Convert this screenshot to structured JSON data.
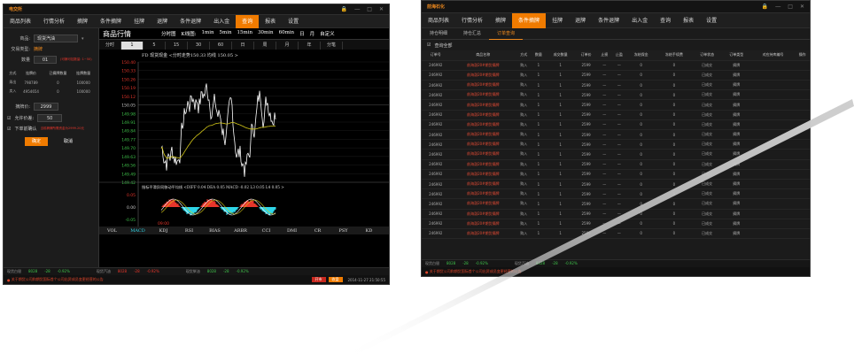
{
  "left": {
    "logo": "电交所",
    "menu": [
      "商品列表",
      "行情分析",
      "摘牌",
      "条件摘牌",
      "挂牌",
      "退牌",
      "条件退牌",
      "出入金",
      "查询",
      "报表",
      "设置"
    ],
    "active_menu": "查询",
    "form": {
      "product_label": "商品:",
      "product_value": "现货汽油",
      "trade_type_label": "交易类型:",
      "trade_type_value": "摘牌",
      "qty_label": "数量",
      "qty_value": "01",
      "qty_hint": "(可摘可挂数量: 1~50)",
      "book_headers": [
        "方式",
        "挂牌价",
        "已摘牌数量",
        "挂牌数量"
      ],
      "book_rows": [
        {
          "side": "乘出",
          "price": "798789",
          "filled": "0",
          "total": "100000"
        },
        {
          "side": "卖入",
          "price": "4954654",
          "filled": "0",
          "total": "100000"
        }
      ],
      "price_label": "摘牌价:",
      "price_value": "2999",
      "deviation_label": "允许价差:",
      "deviation_value": "50",
      "confirm_label": "下单前确认",
      "confirm_hint": "当前摘牌所需资金为2999.20元",
      "ok_label": "确定",
      "cancel_label": "取消"
    },
    "chart_header": {
      "title": "商品行情",
      "tabs": [
        "分时图",
        "K线图:",
        "1min",
        "5min",
        "15min",
        "30min",
        "60min",
        "日",
        "月",
        "自定义"
      ]
    },
    "period_tabs": [
      "分时",
      "1",
      "5",
      "15",
      "30",
      "60",
      "日",
      "周",
      "月",
      "年",
      "分笔"
    ],
    "active_period": "1",
    "chart_legend": "FD 现货现金 <分时走势150.33 均线 150.05 >",
    "price_ticks": [
      "150.40",
      "150.33",
      "150.26",
      "150.19",
      "150.12",
      "150.05",
      "149.98",
      "149.91",
      "149.84",
      "149.77",
      "149.70",
      "149.63",
      "149.56",
      "149.49",
      "149.42"
    ],
    "indicator_legend": "指标平滑异同移动平均线 <DIFF 0.04  DEA 0.05  MACD -0.02  L3 0.05  L4 0.05 >",
    "indicator_ticks": [
      "0.05",
      "0.00",
      "-0.05"
    ],
    "time_label": "09:00",
    "indicators": [
      "VOL",
      "MACD",
      "KDJ",
      "RSI",
      "BIAS",
      "ARBR",
      "CCI",
      "DMI",
      "CR",
      "PSY",
      "KD"
    ],
    "active_indicator": "MACD",
    "status": [
      {
        "name": "现货白银",
        "price": "8028",
        "change": "-28",
        "pct": "-0.92%"
      },
      {
        "name": "现货汽油",
        "price": "8028",
        "change": "-28",
        "pct": "-0.92%"
      },
      {
        "name": "现货柴油",
        "price": "8028",
        "change": "-28",
        "pct": "-0.92%"
      }
    ],
    "notice": "关于期货公司和期货国际首个公司出资成员变更经营的公告",
    "btn_open": "开市",
    "btn_state": "收盘",
    "datetime": "2014-11-27 21:50:55"
  },
  "right": {
    "logo": "前海石化",
    "menu": [
      "商品列表",
      "行情分析",
      "摘牌",
      "条件摘牌",
      "挂牌",
      "退牌",
      "条件退牌",
      "出入金",
      "查询",
      "报表",
      "设置"
    ],
    "active_menu": "条件摘牌",
    "subtabs": [
      "持仓明细",
      "持仓汇总",
      "订单查询"
    ],
    "active_subtab": "订单查询",
    "query_all": "查询全部",
    "headers": [
      "订单号",
      "商品名称",
      "方式",
      "数量",
      "成交数量",
      "订单价",
      "止损",
      "止盈",
      "冻结保金",
      "冻结手续费",
      "订单状态",
      "订单类型",
      "对应持库编号",
      "操作"
    ],
    "rows": [
      {
        "id": "246992",
        "name": "前海渤20#期货摘牌",
        "side": "购入",
        "qty": "1",
        "filled": "1",
        "price": "2599",
        "sl": "—",
        "tp": "—",
        "fm": "0",
        "ff": "0",
        "status": "已成交",
        "type": "摘牌"
      },
      {
        "id": "246992",
        "name": "前海渤20#期货摘牌",
        "side": "购入",
        "qty": "1",
        "filled": "1",
        "price": "2599",
        "sl": "—",
        "tp": "—",
        "fm": "0",
        "ff": "0",
        "status": "已成交",
        "type": "摘牌"
      },
      {
        "id": "246992",
        "name": "前海渤20#期货摘牌",
        "side": "购入",
        "qty": "1",
        "filled": "1",
        "price": "2599",
        "sl": "—",
        "tp": "—",
        "fm": "0",
        "ff": "0",
        "status": "已成交",
        "type": "摘牌"
      },
      {
        "id": "246992",
        "name": "前海渤20#期货摘牌",
        "side": "购入",
        "qty": "1",
        "filled": "1",
        "price": "2599",
        "sl": "—",
        "tp": "—",
        "fm": "0",
        "ff": "0",
        "status": "已成交",
        "type": "摘牌"
      },
      {
        "id": "246992",
        "name": "前海渤20#期货摘牌",
        "side": "购入",
        "qty": "1",
        "filled": "1",
        "price": "2599",
        "sl": "—",
        "tp": "—",
        "fm": "0",
        "ff": "0",
        "status": "已成交",
        "type": "摘牌"
      },
      {
        "id": "246992",
        "name": "前海渤20#期货摘牌",
        "side": "购入",
        "qty": "1",
        "filled": "1",
        "price": "2599",
        "sl": "—",
        "tp": "—",
        "fm": "0",
        "ff": "0",
        "status": "已成交",
        "type": "摘牌"
      },
      {
        "id": "246992",
        "name": "前海渤20#期货摘牌",
        "side": "购入",
        "qty": "1",
        "filled": "1",
        "price": "2599",
        "sl": "—",
        "tp": "—",
        "fm": "0",
        "ff": "0",
        "status": "已成交",
        "type": "摘牌"
      },
      {
        "id": "246992",
        "name": "前海渤20#期货摘牌",
        "side": "购入",
        "qty": "1",
        "filled": "1",
        "price": "2599",
        "sl": "—",
        "tp": "—",
        "fm": "0",
        "ff": "0",
        "status": "已成交",
        "type": "摘牌"
      },
      {
        "id": "246992",
        "name": "前海渤20#期货摘牌",
        "side": "购入",
        "qty": "1",
        "filled": "1",
        "price": "2599",
        "sl": "—",
        "tp": "—",
        "fm": "0",
        "ff": "0",
        "status": "已成交",
        "type": "摘牌"
      },
      {
        "id": "246992",
        "name": "前海渤20#期货摘牌",
        "side": "购入",
        "qty": "1",
        "filled": "1",
        "price": "2599",
        "sl": "—",
        "tp": "—",
        "fm": "0",
        "ff": "0",
        "status": "已成交",
        "type": "摘牌"
      },
      {
        "id": "246992",
        "name": "前海渤20#期货摘牌",
        "side": "购入",
        "qty": "1",
        "filled": "1",
        "price": "2599",
        "sl": "—",
        "tp": "—",
        "fm": "0",
        "ff": "0",
        "status": "已成交",
        "type": "摘牌"
      },
      {
        "id": "246992",
        "name": "前海渤20#期货摘牌",
        "side": "购入",
        "qty": "1",
        "filled": "1",
        "price": "2599",
        "sl": "—",
        "tp": "—",
        "fm": "0",
        "ff": "0",
        "status": "已成交",
        "type": "摘牌"
      },
      {
        "id": "246992",
        "name": "前海渤20#期货摘牌",
        "side": "购入",
        "qty": "1",
        "filled": "1",
        "price": "2599",
        "sl": "—",
        "tp": "—",
        "fm": "0",
        "ff": "0",
        "status": "已成交",
        "type": "摘牌"
      },
      {
        "id": "246992",
        "name": "前海渤20#期货摘牌",
        "side": "购入",
        "qty": "1",
        "filled": "1",
        "price": "2599",
        "sl": "—",
        "tp": "—",
        "fm": "0",
        "ff": "0",
        "status": "已成交",
        "type": "摘牌"
      },
      {
        "id": "246992",
        "name": "前海渤20#期货摘牌",
        "side": "购入",
        "qty": "1",
        "filled": "1",
        "price": "2599",
        "sl": "—",
        "tp": "—",
        "fm": "0",
        "ff": "0",
        "status": "已成交",
        "type": "摘牌"
      },
      {
        "id": "246992",
        "name": "前海渤20#期货摘牌",
        "side": "购入",
        "qty": "1",
        "filled": "1",
        "price": "2599",
        "sl": "—",
        "tp": "—",
        "fm": "0",
        "ff": "0",
        "status": "已成交",
        "type": "摘牌"
      },
      {
        "id": "246992",
        "name": "前海渤20#期货摘牌",
        "side": "购入",
        "qty": "1",
        "filled": "1",
        "price": "2599",
        "sl": "—",
        "tp": "—",
        "fm": "0",
        "ff": "0",
        "status": "已成交",
        "type": "摘牌"
      },
      {
        "id": "246992",
        "name": "前海渤20#期货摘牌",
        "side": "购入",
        "qty": "1",
        "filled": "1",
        "price": "2599",
        "sl": "—",
        "tp": "—",
        "fm": "0",
        "ff": "0",
        "status": "已成交",
        "type": "摘牌"
      }
    ],
    "status": [
      {
        "name": "现货白银",
        "price": "8028",
        "change": "-28",
        "pct": "-0.92%"
      },
      {
        "name": "现货汽油",
        "price": "8028",
        "change": "-28",
        "pct": "-0.92%"
      }
    ],
    "notice": "关于期货公司和期货国际首个公司出资成员变更经营的公告"
  },
  "colors": {
    "accent": "#f07b00",
    "price_line": "#ffffff",
    "avg_line": "#d4c818",
    "macd_pos": "#e8362b",
    "macd_neg": "#2fd6e8"
  }
}
